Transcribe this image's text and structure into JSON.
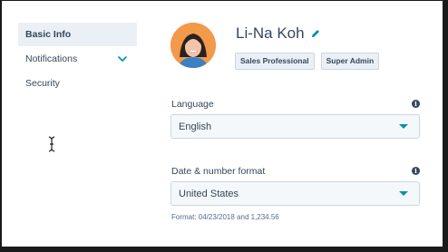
{
  "sidebar": {
    "items": [
      {
        "label": "Basic Info",
        "active": true
      },
      {
        "label": "Notifications",
        "expandable": true
      },
      {
        "label": "Security"
      }
    ]
  },
  "profile": {
    "name": "Li-Na Koh",
    "badges": [
      "Sales Professional",
      "Super Admin"
    ]
  },
  "language": {
    "label": "Language",
    "value": "English"
  },
  "date_format": {
    "label": "Date & number format",
    "value": "United States",
    "hint": "Format: 04/23/2018 and 1,234.56"
  },
  "colors": {
    "accent": "#0091ae",
    "text": "#33475b",
    "avatar_bg": "#f2994a"
  },
  "icons": {
    "edit": "pencil-icon",
    "info": "info-icon",
    "expand": "chevron-down-icon",
    "dropdown": "caret-down-icon",
    "cursor": "text-cursor-icon"
  }
}
